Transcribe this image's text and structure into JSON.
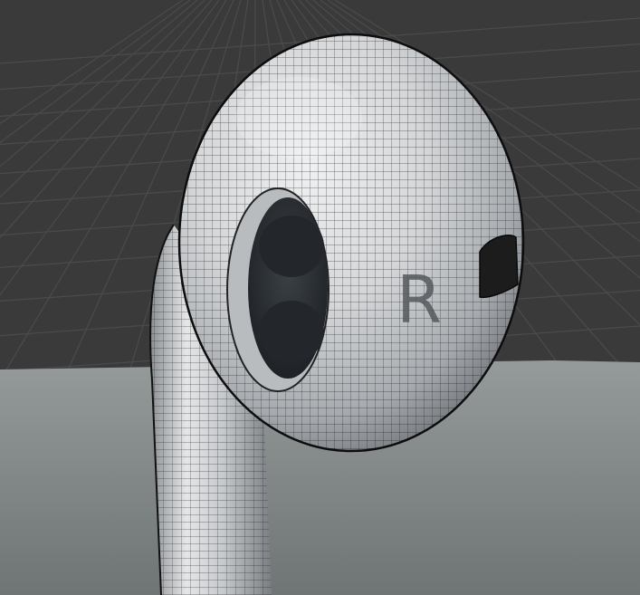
{
  "scene": {
    "marking_text": "R",
    "colors": {
      "background": "#3a3a3a",
      "grid_line": "#4a4a4a",
      "floor": "#7d8282",
      "body": "#d4d6d8",
      "body_shadow": "#7e8286",
      "wire": "#1a1a1a",
      "speaker": "#2b2f33",
      "vent": "#1c1c1c"
    }
  }
}
